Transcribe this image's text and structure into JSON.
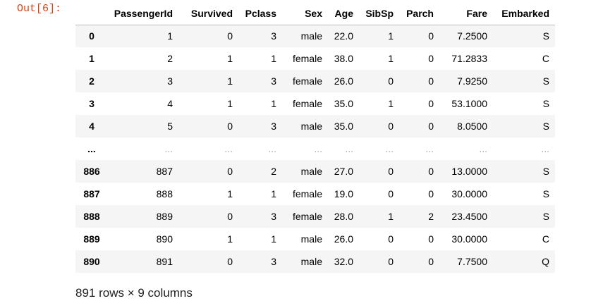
{
  "prompt": "Out[6]:",
  "table": {
    "columns": [
      "PassengerId",
      "Survived",
      "Pclass",
      "Sex",
      "Age",
      "SibSp",
      "Parch",
      "Fare",
      "Embarked"
    ],
    "rows": [
      {
        "index": "0",
        "cells": [
          "1",
          "0",
          "3",
          "male",
          "22.0",
          "1",
          "0",
          "7.2500",
          "S"
        ]
      },
      {
        "index": "1",
        "cells": [
          "2",
          "1",
          "1",
          "female",
          "38.0",
          "1",
          "0",
          "71.2833",
          "C"
        ]
      },
      {
        "index": "2",
        "cells": [
          "3",
          "1",
          "3",
          "female",
          "26.0",
          "0",
          "0",
          "7.9250",
          "S"
        ]
      },
      {
        "index": "3",
        "cells": [
          "4",
          "1",
          "1",
          "female",
          "35.0",
          "1",
          "0",
          "53.1000",
          "S"
        ]
      },
      {
        "index": "4",
        "cells": [
          "5",
          "0",
          "3",
          "male",
          "35.0",
          "0",
          "0",
          "8.0500",
          "S"
        ]
      },
      {
        "index": "...",
        "cells": [
          "...",
          "...",
          "...",
          "...",
          "...",
          "...",
          "...",
          "...",
          "..."
        ]
      },
      {
        "index": "886",
        "cells": [
          "887",
          "0",
          "2",
          "male",
          "27.0",
          "0",
          "0",
          "13.0000",
          "S"
        ]
      },
      {
        "index": "887",
        "cells": [
          "888",
          "1",
          "1",
          "female",
          "19.0",
          "0",
          "0",
          "30.0000",
          "S"
        ]
      },
      {
        "index": "888",
        "cells": [
          "889",
          "0",
          "3",
          "female",
          "28.0",
          "1",
          "2",
          "23.4500",
          "S"
        ]
      },
      {
        "index": "889",
        "cells": [
          "890",
          "1",
          "1",
          "male",
          "26.0",
          "0",
          "0",
          "30.0000",
          "C"
        ]
      },
      {
        "index": "890",
        "cells": [
          "891",
          "0",
          "3",
          "male",
          "32.0",
          "0",
          "0",
          "7.7500",
          "Q"
        ]
      }
    ]
  },
  "summary": "891 rows × 9 columns",
  "colors": {
    "prompt": "#d84315",
    "stripe": "#f5f5f5",
    "ellipsis": "#9e9e9e"
  }
}
